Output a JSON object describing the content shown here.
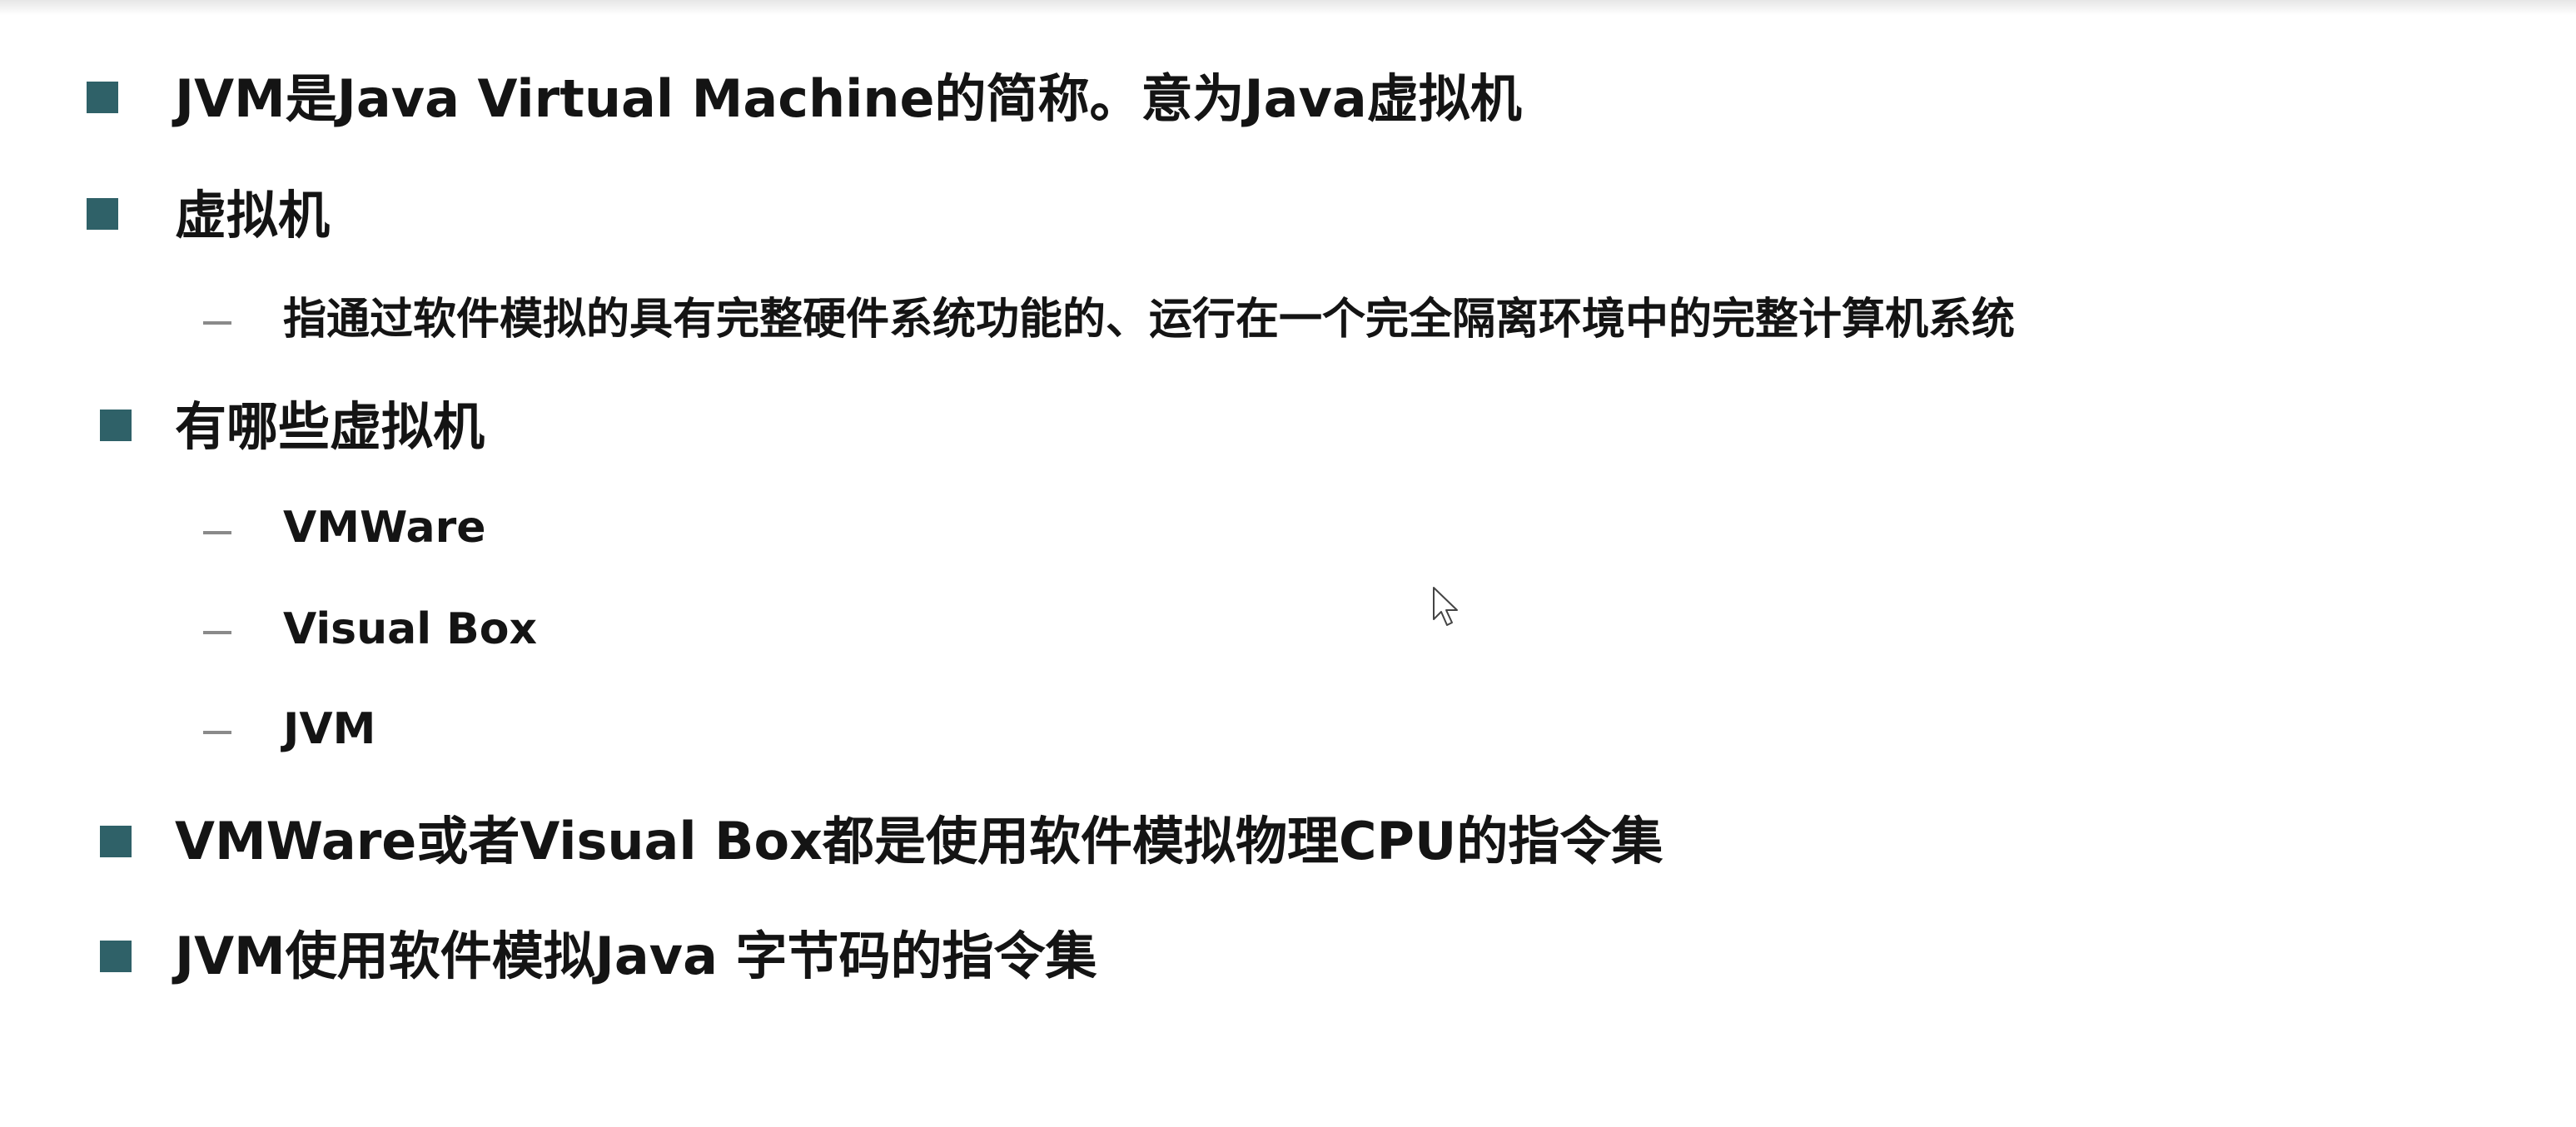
{
  "slide": {
    "bullets": [
      {
        "text": "JVM是Java Virtual Machine的简称。意为Java虚拟机"
      },
      {
        "text": "虚拟机"
      },
      {
        "text": "指通过软件模拟的具有完整硬件系统功能的、运行在一个完全隔离环境中的完整计算机系统"
      },
      {
        "text": "有哪些虚拟机"
      },
      {
        "text": "VMWare"
      },
      {
        "text": "Visual Box"
      },
      {
        "text": "JVM"
      },
      {
        "text": "VMWare或者Visual Box都是使用软件模拟物理CPU的指令集"
      },
      {
        "text": "JVM使用软件模拟Java 字节码的指令集"
      }
    ]
  },
  "colors": {
    "bullet": "#2f6168",
    "dash": "#8a8a8a",
    "text": "#141414",
    "background": "#ffffff"
  },
  "icons": {
    "bullet": "square-bullet-icon",
    "sub_bullet": "dash-bullet-icon",
    "cursor": "mouse-pointer-icon"
  }
}
